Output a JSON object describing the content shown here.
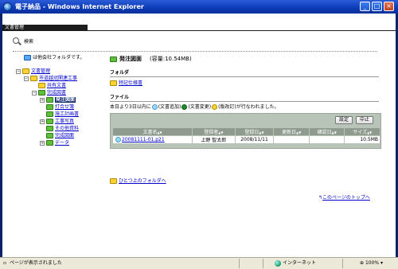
{
  "window": {
    "title": "電子納品 - Windows Internet Explorer",
    "minimize": "_",
    "maximize": "□",
    "close": "×"
  },
  "tab": {
    "label": "文書管理"
  },
  "search": {
    "label": "検索"
  },
  "tree": {
    "header": "は他会社フォルダです。",
    "items": [
      {
        "label": "文書管理"
      },
      {
        "label": "市道越冠関連工事"
      },
      {
        "label": "共有文書"
      },
      {
        "label": "完成図書"
      },
      {
        "label": "発注図面"
      },
      {
        "label": "打合せ簿"
      },
      {
        "label": "施工計画書"
      },
      {
        "label": "工事写真"
      },
      {
        "label": "その他資料"
      },
      {
        "label": "完成図面"
      },
      {
        "label": "データ"
      }
    ]
  },
  "main": {
    "title": "発注図面",
    "capacity": "(容量:10.54MB)",
    "folder_section": "フォルダ",
    "subfolder": "特記仕様書",
    "file_section": "ファイル",
    "legend": {
      "prefix": "本日より3日以内に",
      "added": "(文書追加)",
      "changed": "(文書変更)",
      "revised": "(版改訂)が行なわれました。"
    },
    "buttons": {
      "settings": "設定",
      "abort": "中止"
    },
    "table": {
      "headers": [
        "文書名",
        "登録者",
        "登録日",
        "更新日",
        "確認日",
        "サイズ"
      ],
      "rows": [
        {
          "name": "20081111-01.p21",
          "registrant": "上野 智太郎",
          "registered": "2008/11/11",
          "updated": "",
          "confirmed": "",
          "size": "10.5MB"
        }
      ]
    },
    "up_link": "ひとつ上のフォルダへ",
    "top_link": "このページのトップへ"
  },
  "status": {
    "text": "ページが表示されました",
    "zone": "インターネット",
    "zoom": "100%"
  }
}
